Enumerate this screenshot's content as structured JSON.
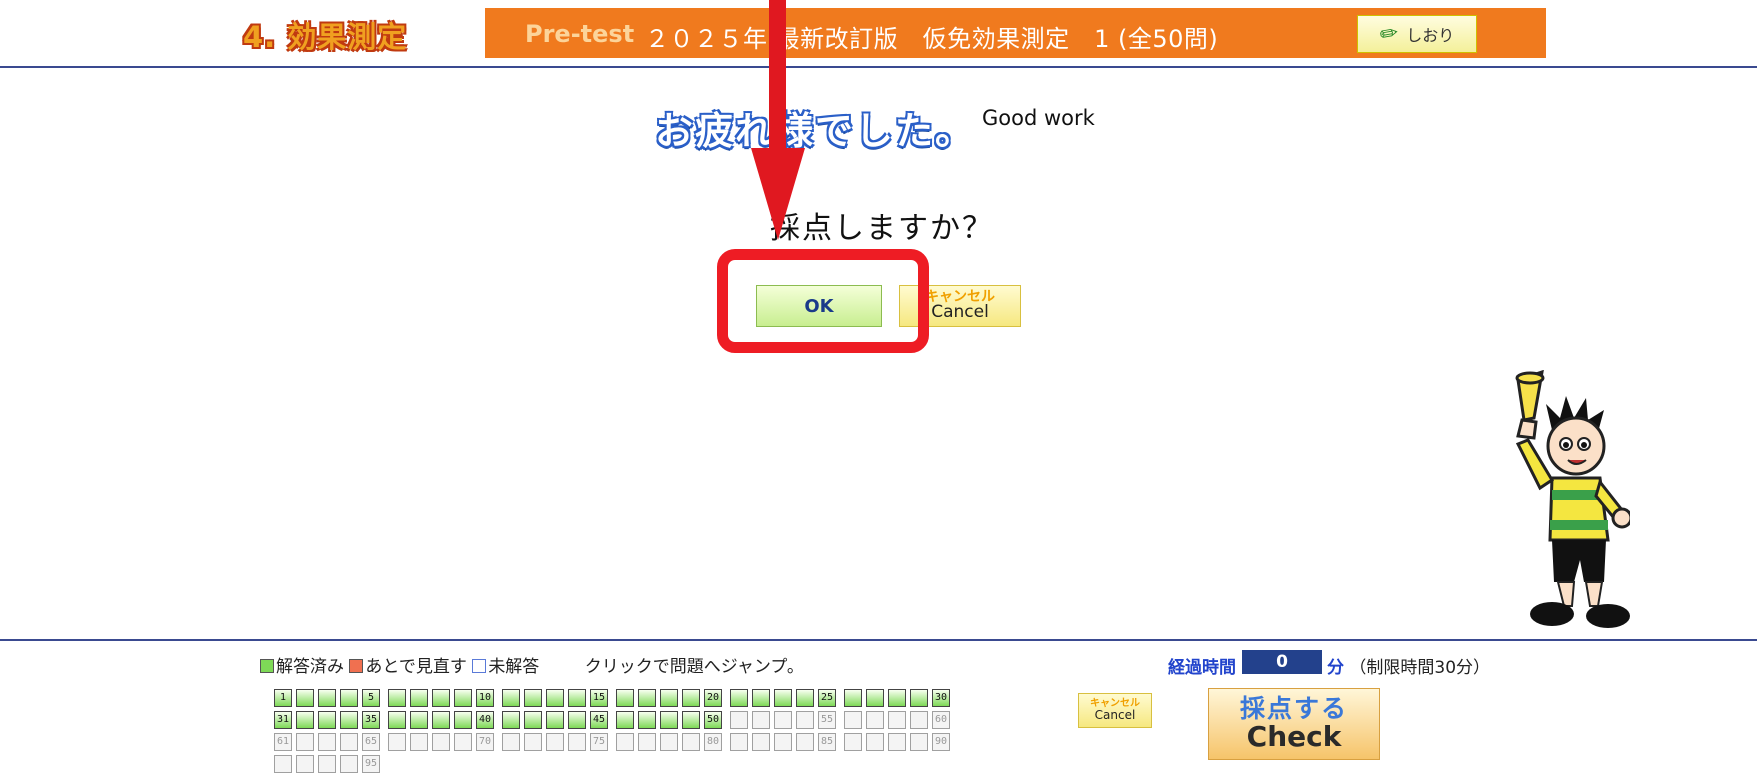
{
  "header": {
    "section_title": "4. 効果測定",
    "pretest_label": "Pre-test",
    "exam_title": "２０２５年 最新改訂版　仮免効果測定　1 (全50問)",
    "bookmark_label": "しおり"
  },
  "dialog": {
    "good_work_jp": "お疲れ様でした。",
    "good_work_en": "Good work",
    "question": "採点しますか？",
    "ok_label": "OK",
    "cancel_jp": "キャンセル",
    "cancel_en": "Cancel"
  },
  "footer": {
    "legend_answered": "解答済み",
    "legend_review": "あとで見直す",
    "legend_unanswered": "未解答",
    "jump_hint": "クリックで問題へジャンプ。",
    "elapsed_label": "経過時間",
    "elapsed_value": "0",
    "elapsed_unit": "分",
    "time_limit": "（制限時間30分）",
    "cancel_jp": "キャンセル",
    "cancel_en": "Cancel",
    "check_jp": "採点する",
    "check_en": "Check",
    "questions": {
      "total_cells": 95,
      "answered_count": 50,
      "labeled_numbers": [
        1,
        5,
        10,
        15,
        20,
        25,
        30,
        31,
        35,
        40,
        45,
        50,
        55,
        60,
        61,
        65,
        70,
        75,
        80,
        85,
        90,
        95
      ]
    }
  },
  "colors": {
    "header_orange": "#f07a1e",
    "answered_green": "#7ed957",
    "annotation_red": "#ee1c24",
    "elapsed_navy": "#23418c"
  }
}
